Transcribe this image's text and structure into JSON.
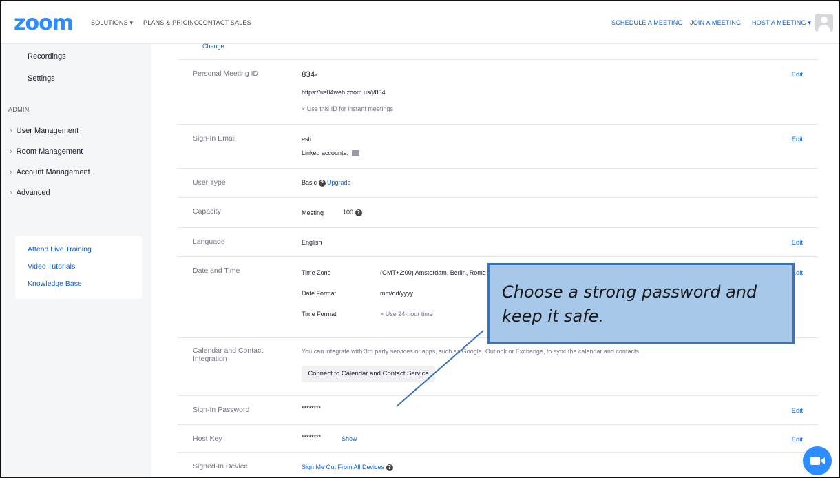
{
  "nav": {
    "logo": "zoom",
    "solutions": "SOLUTIONS ▾",
    "plans": "PLANS & PRICING",
    "contact": "CONTACT SALES",
    "schedule": "SCHEDULE A MEETING",
    "join": "JOIN A MEETING",
    "host": "HOST A MEETING ▾"
  },
  "sidebar": {
    "recordings": "Recordings",
    "settings": "Settings",
    "admin": "ADMIN",
    "groups": [
      "User Management",
      "Room Management",
      "Account Management",
      "Advanced"
    ],
    "chevron": "›",
    "links": [
      "Attend Live Training",
      "Video Tutorials",
      "Knowledge Base"
    ]
  },
  "profile": {
    "change": "Change",
    "pmi_label": "Personal Meeting ID",
    "pmi_value": "834-",
    "pmi_url": "https://us04web.zoom.us/j/834",
    "pmi_instant": "Use this ID for instant meetings",
    "email_label": "Sign-In Email",
    "email_value": "esti",
    "linked": "Linked accounts:",
    "user_type_label": "User Type",
    "user_type_value": "Basic",
    "upgrade": "Upgrade",
    "capacity_label": "Capacity",
    "capacity_meeting": "Meeting",
    "capacity_value": "100",
    "language_label": "Language",
    "language_value": "English",
    "datetime_label": "Date and Time",
    "tz_label": "Time Zone",
    "tz_value": "(GMT+2:00) Amsterdam, Berlin, Rome",
    "df_label": "Date Format",
    "df_value": "mm/dd/yyyy",
    "tf_label": "Time Format",
    "tf_value": "Use 24-hour time",
    "calendar_label": "Calendar and Contact Integration",
    "calendar_desc": "You can integrate with 3rd party services or apps, such as Google, Outlook or Exchange, to sync the calendar and contacts.",
    "calendar_button": "Connect to Calendar and Contact Service",
    "password_label": "Sign-In Password",
    "password_value": "********",
    "hostkey_label": "Host Key",
    "hostkey_value": "********",
    "show": "Show",
    "device_label": "Signed-In Device",
    "device_action": "Sign Me Out From All Devices",
    "edit": "Edit",
    "x_mark": "×",
    "help_mark": "?"
  },
  "callout": {
    "text": "Choose a strong password and keep it safe."
  },
  "colors": {
    "brand": "#2D8CFF",
    "link": "#0E5FD8",
    "callout_fill": "#a7c8e8",
    "callout_border": "#3c73b8"
  },
  "icons": {
    "avatar": "user-avatar-icon",
    "help": "question-circle-icon",
    "linked": "linked-account-icon",
    "chat": "zoom-video-chat-icon"
  }
}
